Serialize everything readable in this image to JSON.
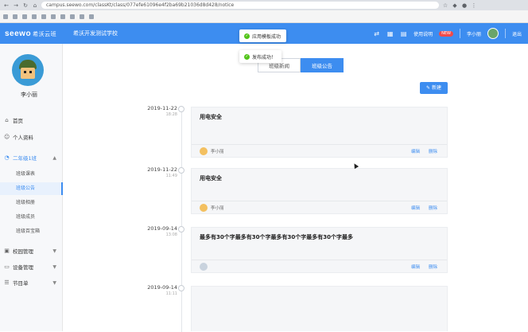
{
  "browser": {
    "url": "campus.seewo.com/classKt/class/077efe61096e4f2ba69b21036d8d428/notice",
    "bookmarks": []
  },
  "appbar": {
    "logo": "seewo",
    "logo_suffix": "希沃云班",
    "school": "希沃开发测试学校",
    "usage_label": "使用说明",
    "new_badge": "NEW",
    "user": "李小丽",
    "logout": "退出"
  },
  "toasts": {
    "first": "应用模板成功",
    "second": "发布成功！"
  },
  "sidebar": {
    "user_name": "李小丽",
    "items": {
      "home": "首页",
      "profile": "个人资料",
      "class": "二年级1班",
      "class_sub": [
        "班级课表",
        "班级公告",
        "班级相册",
        "班级成员",
        "班级百宝箱"
      ],
      "school": "校园管理",
      "device": "设备管理",
      "program": "节目单"
    }
  },
  "main": {
    "tabs": [
      "班级新闻",
      "班级公告"
    ],
    "active_tab": 1,
    "new_button": "新建",
    "notices": [
      {
        "date": "2019-11-22",
        "time": "18:28",
        "title": "用电安全",
        "body": "",
        "author": "李小丽",
        "edit": "编辑",
        "delete": "删除"
      },
      {
        "date": "2019-11-22",
        "time": "11:49",
        "title": "用电安全",
        "body": "",
        "author": "李小丽",
        "edit": "编辑",
        "delete": "删除"
      },
      {
        "date": "2019-09-14",
        "time": "13:08",
        "title": "最多有30个字最多有30个字最多有30个字最多有30个字最多",
        "body": "",
        "author": "",
        "edit": "编辑",
        "delete": "删除"
      },
      {
        "date": "2019-09-14",
        "time": "11:11",
        "title": "",
        "body": "",
        "author": "",
        "edit": "",
        "delete": ""
      }
    ]
  },
  "colors": {
    "brand": "#3d8df0",
    "danger": "#f04a4a",
    "success": "#52c41a"
  }
}
